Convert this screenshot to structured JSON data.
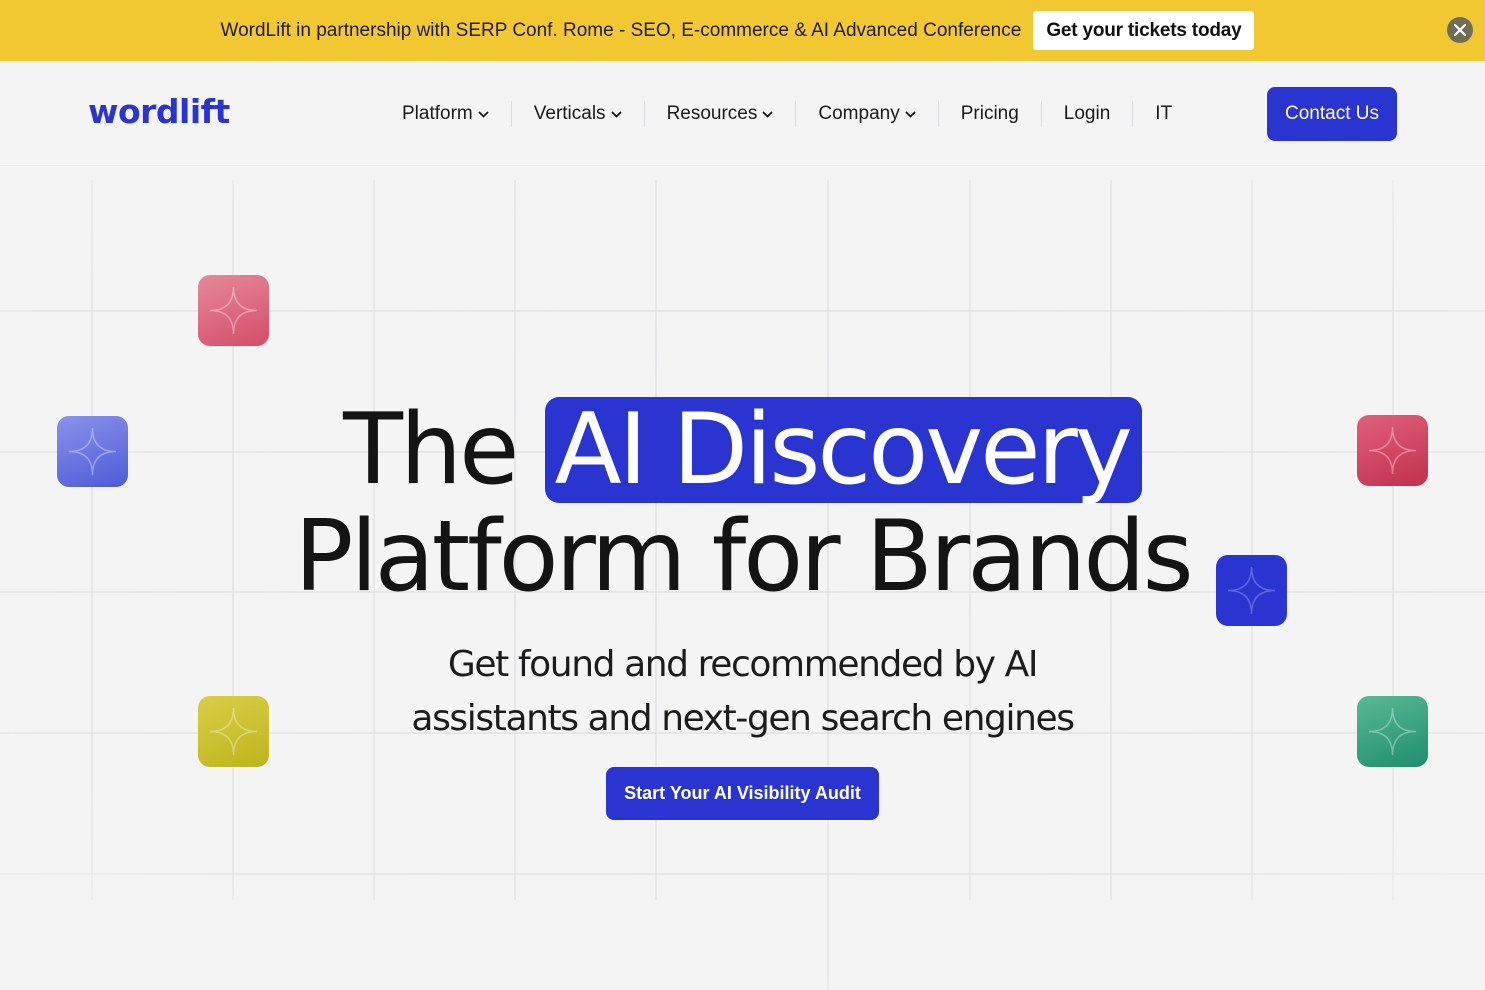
{
  "announcement": {
    "text": "WordLift in partnership with SERP Conf. Rome - SEO, E-commerce & AI Advanced Conference",
    "button_label": "Get your tickets today",
    "close_icon": "close-icon",
    "background": "#f1c832"
  },
  "header": {
    "logo_text": "wordlift",
    "nav": [
      {
        "label": "Platform",
        "has_dropdown": true
      },
      {
        "label": "Verticals",
        "has_dropdown": true
      },
      {
        "label": "Resources",
        "has_dropdown": true
      },
      {
        "label": "Company",
        "has_dropdown": true
      },
      {
        "label": "Pricing",
        "has_dropdown": false
      },
      {
        "label": "Login",
        "has_dropdown": false
      },
      {
        "label": "IT",
        "has_dropdown": false
      }
    ],
    "contact_label": "Contact Us"
  },
  "hero": {
    "headline_prefix": "The",
    "headline_highlight": "AI Discovery",
    "headline_line2": "Platform for Brands",
    "subhead_line1": "Get found and recommended by AI",
    "subhead_line2": "assistants and next-gen search engines",
    "cta_label": "Start Your AI Visibility Audit"
  },
  "colors": {
    "brand_blue": "#2a35d1",
    "tile_pink": "#d9566f",
    "tile_lavender": "#6a74e0",
    "tile_olive": "#c9bd22",
    "tile_crimson": "#c8385a",
    "tile_blue": "#2a35d1",
    "tile_green": "#2a9a78"
  }
}
